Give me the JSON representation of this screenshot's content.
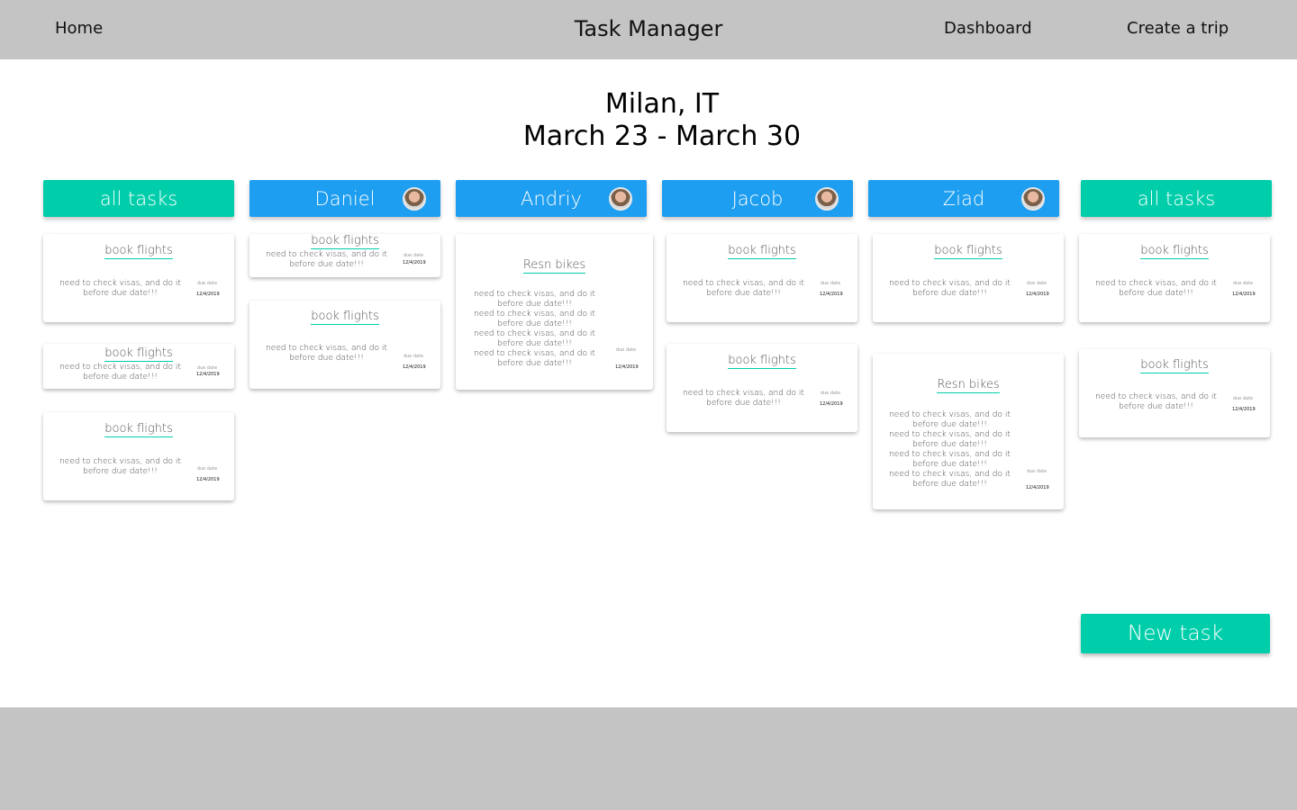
{
  "nav": {
    "home": "Home",
    "brand": "Task Manager",
    "dashboard": "Dashboard",
    "create_trip": "Create a trip"
  },
  "trip": {
    "city": "Milan, IT",
    "dates": "March 23 - March 30"
  },
  "columns": {
    "c0": {
      "label": "all tasks",
      "color": "#00ceab"
    },
    "c1": {
      "label": "Daniel",
      "color": "#1e9ef0"
    },
    "c2": {
      "label": "Andriy",
      "color": "#1e9ef0"
    },
    "c3": {
      "label": "Jacob",
      "color": "#1e9ef0"
    },
    "c4": {
      "label": "Ziad",
      "color": "#1e9ef0"
    },
    "c5": {
      "label": "all tasks",
      "color": "#00ceab"
    }
  },
  "task": {
    "book_title": "book flights",
    "bikes_title": "Resn bikes",
    "desc": "need to check visas, and do it before due date!!!",
    "due_label": "due date",
    "due_date": "12/4/2019"
  },
  "actions": {
    "new_task": "New task"
  }
}
